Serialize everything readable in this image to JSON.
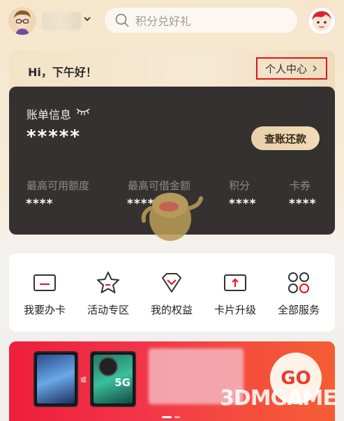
{
  "header": {
    "search_placeholder": "积分兑好礼"
  },
  "greeting": {
    "text": "Hi，下午好！",
    "personal_center": "个人中心"
  },
  "bill": {
    "title": "账单信息",
    "amount_masked": "*****",
    "check_button": "查账还款",
    "stats": [
      {
        "label": "最高可用额度",
        "value": "****"
      },
      {
        "label": "最高可借金额",
        "value": "****"
      },
      {
        "label": "积分",
        "value": "****"
      },
      {
        "label": "卡券",
        "value": "****"
      }
    ]
  },
  "services": [
    {
      "label": "我要办卡",
      "icon": "card-icon"
    },
    {
      "label": "活动专区",
      "icon": "star-icon"
    },
    {
      "label": "我的权益",
      "icon": "diamond-icon"
    },
    {
      "label": "卡片升级",
      "icon": "card-upgrade-icon"
    },
    {
      "label": "全部服务",
      "icon": "grid-icon"
    }
  ],
  "banner": {
    "go_label": "GO",
    "or_text": "或",
    "badge_5g": "5G"
  },
  "watermark": "3DMGAME",
  "colors": {
    "accent_red": "#e2141c",
    "dark_card": "#343130",
    "gold_button": "#e8d1a9",
    "banner_red": "#ee1e3c"
  }
}
